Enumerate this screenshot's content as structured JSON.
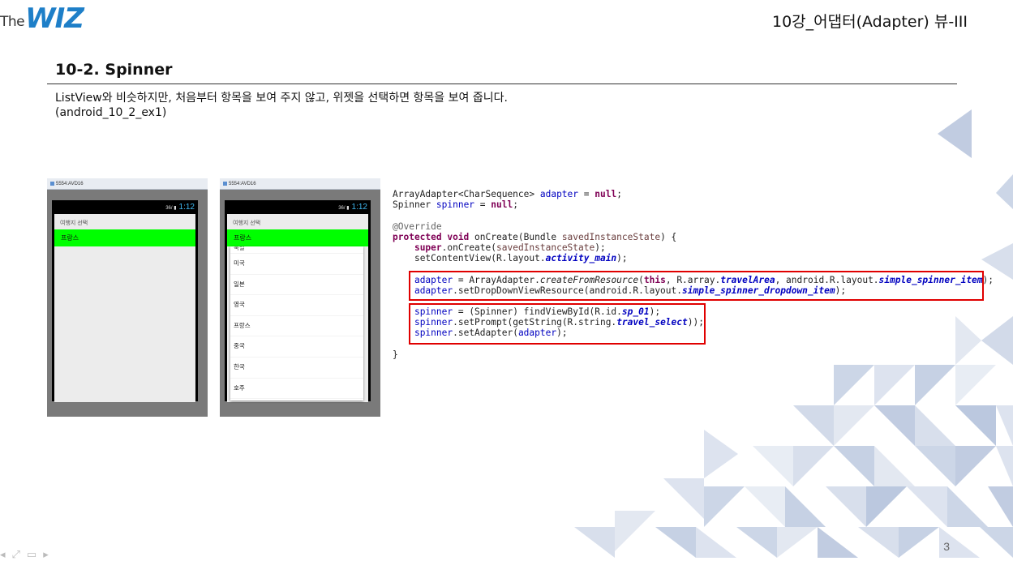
{
  "header": {
    "logo_prefix": "The",
    "logo_main": "WIZ",
    "lecture_title": "10강_어댑터(Adapter) 뷰-III"
  },
  "slide": {
    "section_title": "10-2. Spinner",
    "description_line1": "ListView와 비슷하지만, 처음부터 항목을 보여 주지 않고, 위젯을 선택하면 항목을 보여 줍니다.",
    "description_line2": "(android_10_2_ex1)",
    "page_number": "3"
  },
  "emulator_left": {
    "window_title": "5554:AVD16",
    "status_signal": "36/ ▮",
    "time": "1:12",
    "prompt": "여행지 선택",
    "selected_item": "프랑스"
  },
  "emulator_right": {
    "window_title": "5554:AVD16",
    "status_signal": "36/ ▮",
    "time": "1:12",
    "prompt": "여행지 선택",
    "selected_item": "프랑스",
    "dropdown_items": [
      "북일",
      "미국",
      "일본",
      "영국",
      "프랑스",
      "중국",
      "한국",
      "호주"
    ]
  },
  "code": {
    "line1_a": "ArrayAdapter<CharSequence> ",
    "line1_b": "adapter",
    "line1_c": " = ",
    "line1_d": "null",
    "line1_e": ";",
    "line2_a": "Spinner ",
    "line2_b": "spinner",
    "line2_c": " = ",
    "line2_d": "null",
    "line2_e": ";",
    "line3": "@Override",
    "line4_a": "protected void",
    "line4_b": " onCreate(Bundle ",
    "line4_c": "savedInstanceState",
    "line4_d": ") {",
    "line5_a": "super",
    "line5_b": ".onCreate(",
    "line5_c": "savedInstanceState",
    "line5_d": ");",
    "line6_a": "setContentView(R.layout.",
    "line6_b": "activity_main",
    "line6_c": ");",
    "line7_a": "adapter",
    "line7_b": " = ArrayAdapter.",
    "line7_c": "createFromResource",
    "line7_d": "(",
    "line7_e": "this",
    "line7_f": ", R.array.",
    "line7_g": "travelArea",
    "line7_h": ", android.R.layout.",
    "line7_i": "simple_spinner_item",
    "line7_j": ");",
    "line8_a": "adapter",
    "line8_b": ".setDropDownViewResource(android.R.layout.",
    "line8_c": "simple_spinner_dropdown_item",
    "line8_d": ");",
    "line9_a": "spinner",
    "line9_b": " = (Spinner) findViewById(R.id.",
    "line9_c": "sp_01",
    "line9_d": ");",
    "line10_a": "spinner",
    "line10_b": ".setPrompt(getString(R.string.",
    "line10_c": "travel_select",
    "line10_d": "));",
    "line11_a": "spinner",
    "line11_b": ".setAdapter(",
    "line11_c": "adapter",
    "line11_d": ");",
    "line12": "}"
  },
  "colors": {
    "keyword": "#7f0055",
    "field": "#0000c0",
    "highlight_box": "#e00000",
    "spinner_selected": "#00ff00",
    "decor_triangles": "#8ea3c9"
  }
}
